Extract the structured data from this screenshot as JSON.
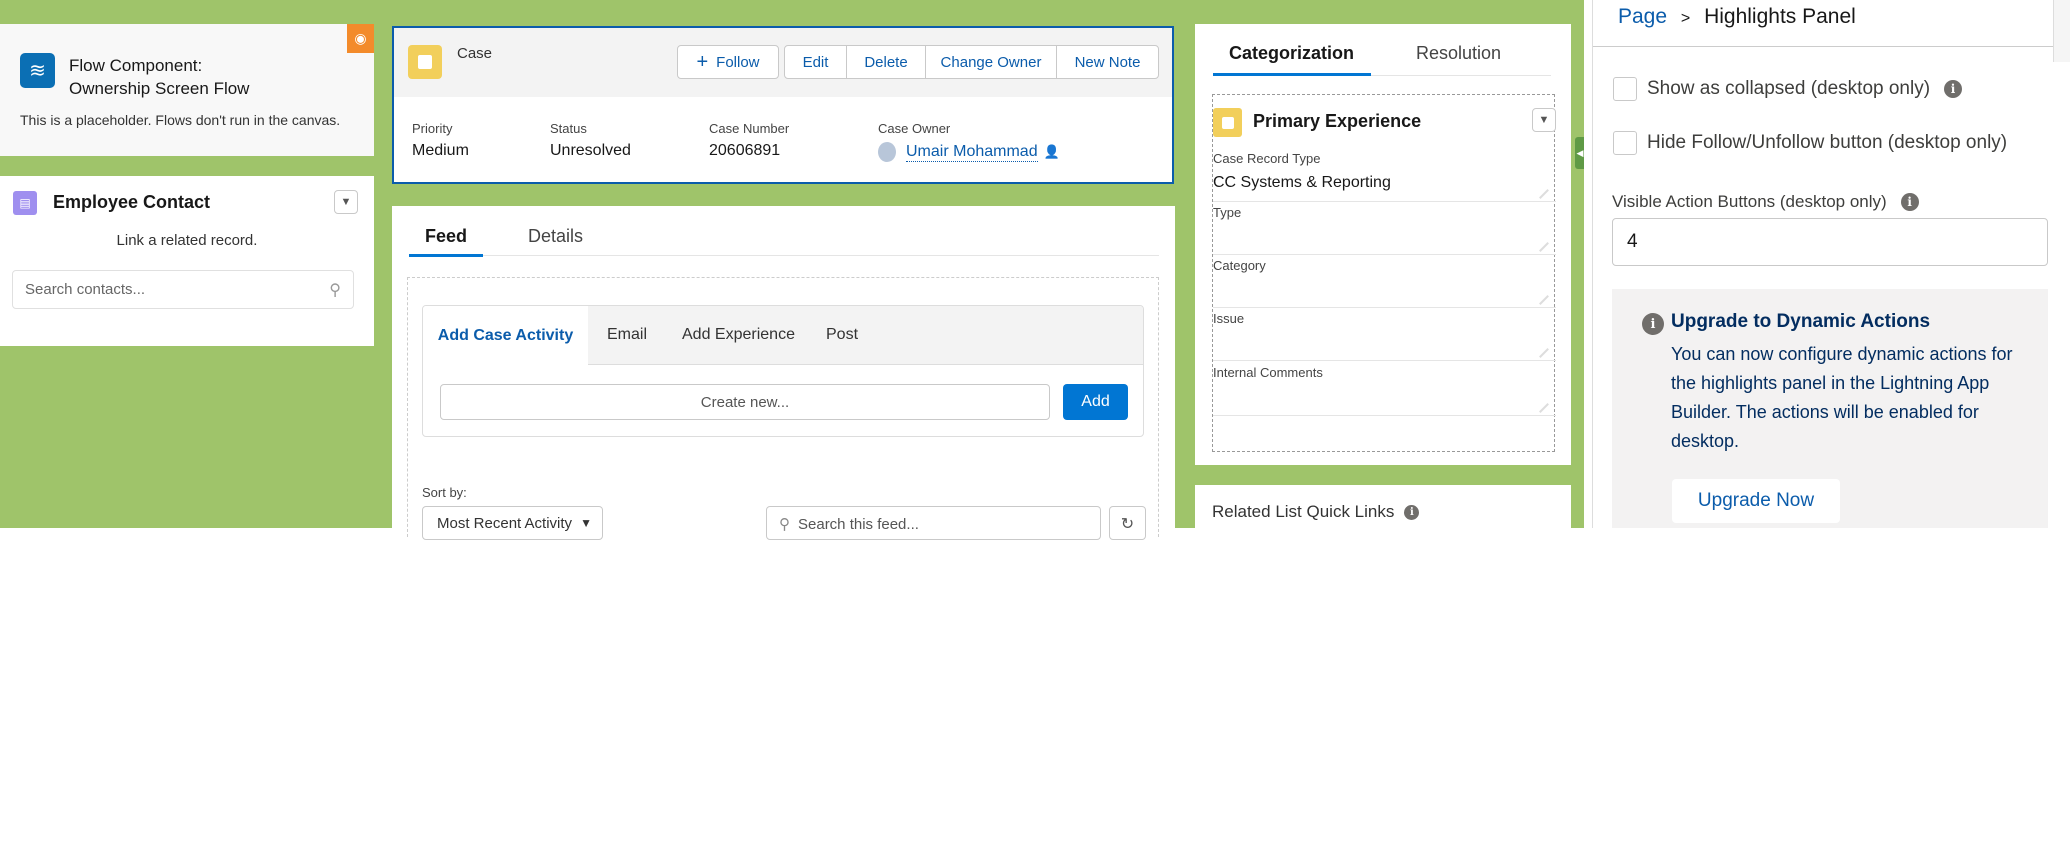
{
  "flow": {
    "title_line1": "Flow Component:",
    "title_line2": "Ownership Screen Flow",
    "placeholder": "This is a placeholder. Flows don't run in the canvas.",
    "icon": "flow-icon",
    "badge_icon": "eye-icon"
  },
  "employee_contact": {
    "title": "Employee Contact",
    "message": "Link a related record.",
    "search_placeholder": "Search contacts..."
  },
  "highlights": {
    "object": "Case",
    "buttons": {
      "follow": "Follow",
      "edit": "Edit",
      "delete": "Delete",
      "change_owner": "Change Owner",
      "new_note": "New Note"
    },
    "fields": [
      {
        "label": "Priority",
        "value": "Medium"
      },
      {
        "label": "Status",
        "value": "Unresolved"
      },
      {
        "label": "Case Number",
        "value": "20606891"
      },
      {
        "label": "Case Owner",
        "value": "Umair Mohammad"
      }
    ]
  },
  "feed": {
    "tabs": [
      "Feed",
      "Details"
    ],
    "publisher_tabs": [
      "Add Case Activity",
      "Email",
      "Add Experience",
      "Post"
    ],
    "create_placeholder": "Create new...",
    "add_label": "Add",
    "sort_label": "Sort by:",
    "sort_value": "Most Recent Activity",
    "search_placeholder": "Search this feed..."
  },
  "categorization": {
    "tabs": [
      "Categorization",
      "Resolution"
    ],
    "section_title": "Primary Experience",
    "fields": [
      {
        "label": "Case Record Type",
        "value": "CC Systems & Reporting"
      },
      {
        "label": "Type",
        "value": ""
      },
      {
        "label": "Category",
        "value": ""
      },
      {
        "label": "Issue",
        "value": ""
      },
      {
        "label": "Internal Comments",
        "value": ""
      }
    ]
  },
  "related_links": {
    "title": "Related List Quick Links"
  },
  "properties": {
    "breadcrumb_root": "Page",
    "breadcrumb_sep": ">",
    "breadcrumb_current": "Highlights Panel",
    "show_collapsed": "Show as collapsed (desktop only)",
    "hide_follow": "Hide Follow/Unfollow button (desktop only)",
    "visible_buttons_label": "Visible Action Buttons (desktop only)",
    "visible_buttons_value": "4",
    "upgrade_title": "Upgrade to Dynamic Actions",
    "upgrade_body": "You can now configure dynamic actions for the highlights panel in the Lightning App Builder. The actions will be enabled for desktop.",
    "upgrade_button": "Upgrade Now"
  },
  "colors": {
    "canvas_green": "#9fc46a",
    "brand_blue": "#0176d3",
    "link_blue": "#0b5cab",
    "flow_orange": "#f38b2b"
  }
}
